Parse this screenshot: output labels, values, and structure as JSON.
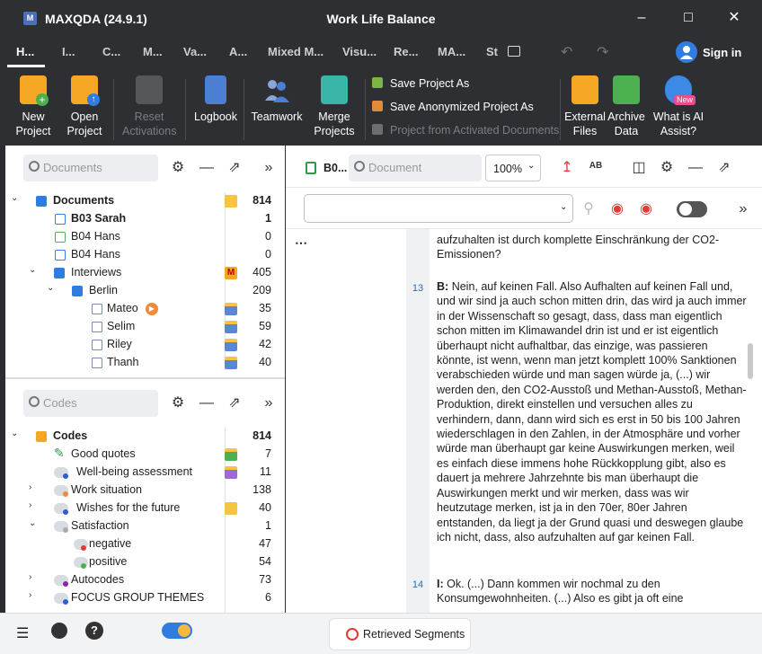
{
  "titlebar": {
    "app": "MAXQDA (24.9.1)",
    "document": "Work Life Balance"
  },
  "tabs": [
    "H...",
    "I...",
    "C...",
    "M...",
    "Va...",
    "A...",
    "Mixed M...",
    "Visu...",
    "Re...",
    "MA...",
    "St"
  ],
  "signin": "Sign in",
  "ribbon": {
    "new_project": "New Project",
    "open_project": "Open Project",
    "reset_activations": "Reset Activations",
    "logbook": "Logbook",
    "teamwork": "Teamwork",
    "merge_projects": "Merge Projects",
    "save_as": "Save Project As",
    "save_anon": "Save Anonymized Project As",
    "from_activated": "Project from Activated Documents",
    "external_files": "External Files",
    "archive_data": "Archive Data",
    "ai_assist": "What is AI Assist?",
    "new_badge": "New"
  },
  "documents_panel": {
    "search_placeholder": "Documents",
    "rows": [
      {
        "label": "Documents",
        "count": "814"
      },
      {
        "label": "B03 Sarah",
        "count": "1"
      },
      {
        "label": "B04 Hans",
        "count": "0"
      },
      {
        "label": "B04 Hans",
        "count": "0"
      },
      {
        "label": "Interviews",
        "count": "405"
      },
      {
        "label": "Berlin",
        "count": "209"
      },
      {
        "label": "Mateo",
        "count": "35"
      },
      {
        "label": "Selim",
        "count": "59"
      },
      {
        "label": "Riley",
        "count": "42"
      },
      {
        "label": "Thanh",
        "count": "40"
      }
    ]
  },
  "codes_panel": {
    "search_placeholder": "Codes",
    "rows": [
      {
        "label": "Codes",
        "count": "814"
      },
      {
        "label": "Good quotes",
        "count": "7"
      },
      {
        "label": "Well-being assessment",
        "count": "11"
      },
      {
        "label": "Work situation",
        "count": "138"
      },
      {
        "label": "Wishes for the future",
        "count": "40"
      },
      {
        "label": "Satisfaction",
        "count": "1"
      },
      {
        "label": "negative",
        "count": "47"
      },
      {
        "label": "positive",
        "count": "54"
      },
      {
        "label": "Autocodes",
        "count": "73"
      },
      {
        "label": "FOCUS GROUP THEMES",
        "count": "6"
      }
    ]
  },
  "document_browser": {
    "doc_tab": "B0...",
    "search_placeholder": "Document",
    "zoom": "100%",
    "para_top": "aufzuhalten ist durch komplette Einschränkung der CO2-Emissionen?",
    "para13_num": "13",
    "para13_speaker": "B:",
    "para13": "Nein, auf keinen Fall. Also Aufhalten auf keinen Fall und, und wir sind ja auch schon mitten drin, das wird ja auch immer in der Wissenschaft so gesagt, dass, dass man eigentlich schon mitten im Klimawandel drin ist und er ist eigentlich überhaupt nicht aufhaltbar, das einzige, was passieren könnte, ist wenn, wenn man jetzt komplett 100% Sanktionen verabschieden würde und man sagen würde ja, (...) wir werden den, den CO2-Ausstoß und Methan-Ausstoß, Methan-Produktion, direkt einstellen und versuchen alles zu verhindern, dann, dann wird sich es erst in 50 bis 100 Jahren wiederschlagen in den Zahlen, in der Atmosphäre und vorher würde man überhaupt gar keine Auswirkungen merken, weil es einfach diese immens hohe Rückkopplung gibt, also es dauert ja mehrere Jahrzehnte bis man überhaupt die Auswirkungen merkt und wir merken, dass was wir heutzutage merken, ist ja in den 70er, 80er Jahren entstanden, da liegt ja der Grund quasi und deswegen glaube ich nicht, dass, also aufzuhalten auf gar keinen Fall.",
    "para14_num": "14",
    "para14_speaker": "I:",
    "para14": "Ok. (...) Dann kommen wir nochmal zu den Konsumgewohnheiten. (...) Also es gibt ja oft eine"
  },
  "bottom": {
    "retrieved_segments": "Retrieved Segments"
  }
}
